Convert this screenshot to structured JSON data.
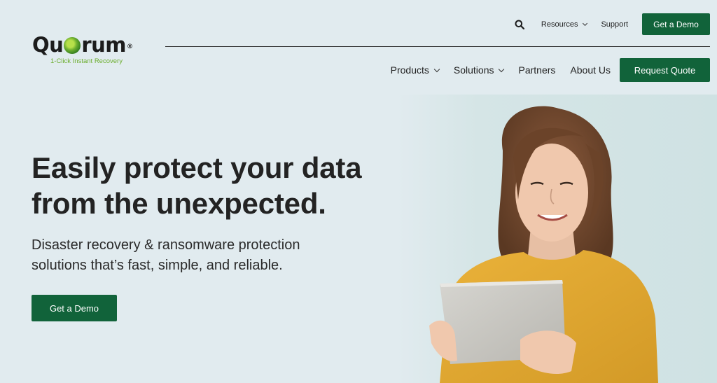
{
  "brand": {
    "name_pre": "Qu",
    "name_post": "rum",
    "registered": "®",
    "tagline": "1-Click Instant Recovery"
  },
  "util_nav": {
    "search_icon": "search-icon",
    "resources": "Resources",
    "support": "Support",
    "demo": "Get a Demo"
  },
  "main_nav": {
    "items": [
      "Products",
      "Solutions",
      "Partners",
      "About Us"
    ],
    "quote": "Request Quote"
  },
  "hero": {
    "title_line1": "Easily protect your data",
    "title_line2": "from the unexpected.",
    "subtitle_line1": "Disaster recovery & ransomware protection",
    "subtitle_line2": "solutions that’s fast, simple, and reliable.",
    "cta": "Get a Demo"
  },
  "colors": {
    "background": "#e1ebef",
    "brand_green": "#11633a",
    "logo_green": "#6cae2e"
  }
}
